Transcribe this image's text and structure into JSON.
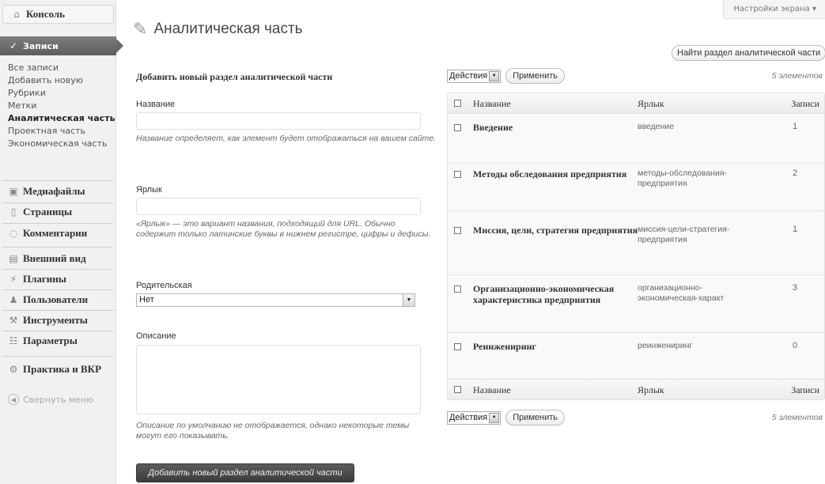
{
  "sidebar": {
    "console": "Консоль",
    "posts": "Записи",
    "submenu": [
      "Все записи",
      "Добавить новую",
      "Рубрики",
      "Метки",
      "Аналитическая часть",
      "Проектная часть",
      "Экономическая часть"
    ],
    "media": "Медиафайлы",
    "pages": "Страницы",
    "comments": "Комментарии",
    "appearance": "Внешний вид",
    "plugins": "Плагины",
    "users": "Пользователи",
    "tools": "Инструменты",
    "settings": "Параметры",
    "practice": "Практика и ВКР",
    "collapse": "Свернуть меню"
  },
  "header": {
    "title": "Аналитическая часть",
    "screen_options": "Настройки экрана",
    "search_button": "Найти раздел аналитической части"
  },
  "form": {
    "title": "Добавить новый раздел аналитической части",
    "name_label": "Название",
    "name_hint": "Название определяет, как элемент будет отображаться на вашем сайте.",
    "slug_label": "Ярлык",
    "slug_hint": "«Ярлык» — это вариант названия, подходящий для URL. Обычно содержит только латинские буквы в нижнем регистре, цифры и дефисы.",
    "parent_label": "Родительская",
    "parent_value": "Нет",
    "desc_label": "Описание",
    "desc_hint": "Описание по умолчанию не отображается, однако некоторые темы могут его показывать.",
    "submit": "Добавить новый раздел аналитической части"
  },
  "table": {
    "bulk_label": "Действия",
    "apply": "Применить",
    "count": "5 элементов",
    "col_name": "Название",
    "col_slug": "Ярлык",
    "col_posts": "Записи",
    "rows": [
      {
        "name": "Введение",
        "slug": "введение",
        "posts": "1"
      },
      {
        "name": "Методы обследования предприятия",
        "slug": "методы-обследования-предприятия",
        "posts": "2"
      },
      {
        "name": "Миссия, цели, стратегия предприятия",
        "slug": "миссия-цели-стратегия-предприятия",
        "posts": "1"
      },
      {
        "name": "Организационно-экономическая характеристика предприятия",
        "slug": "организационно-экономическая-характ",
        "posts": "3"
      },
      {
        "name": "Реинжениринг",
        "slug": "реинжениринг",
        "posts": "0"
      }
    ]
  }
}
